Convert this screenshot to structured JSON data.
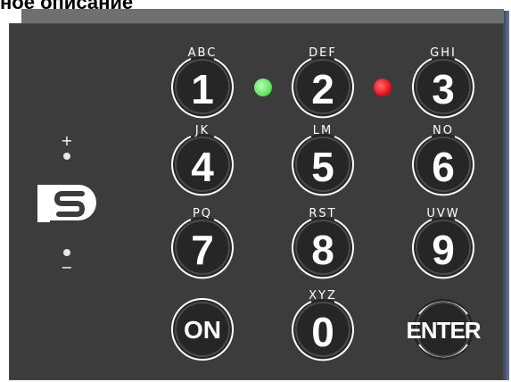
{
  "heading": "ное описание",
  "keys": [
    {
      "id": "1",
      "digit": "1",
      "letters": "ABC"
    },
    {
      "id": "2",
      "digit": "2",
      "letters": "DEF"
    },
    {
      "id": "3",
      "digit": "3",
      "letters": "GHI"
    },
    {
      "id": "4",
      "digit": "4",
      "letters": "JK"
    },
    {
      "id": "5",
      "digit": "5",
      "letters": "LM"
    },
    {
      "id": "6",
      "digit": "6",
      "letters": "NO"
    },
    {
      "id": "7",
      "digit": "7",
      "letters": "PQ"
    },
    {
      "id": "8",
      "digit": "8",
      "letters": "RST"
    },
    {
      "id": "9",
      "digit": "9",
      "letters": "UVW"
    },
    {
      "id": "on",
      "digit": "ON",
      "letters": ""
    },
    {
      "id": "0",
      "digit": "0",
      "letters": "XYZ"
    },
    {
      "id": "enter",
      "digit": "ENTER",
      "letters": ""
    }
  ],
  "indicators": {
    "green_color": "#66e366",
    "red_color": "#e8101a"
  },
  "volume": {
    "plus": "+",
    "minus": "−"
  },
  "colors": {
    "panel": "#3c3c3c",
    "key_face": "#2a2a2a",
    "key_ring": "#ffffff"
  },
  "logo_icon": "s-logo-icon"
}
